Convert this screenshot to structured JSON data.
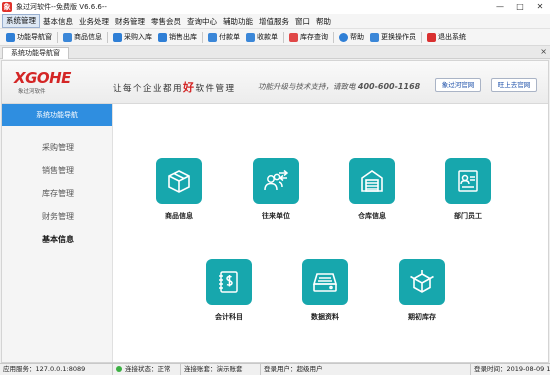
{
  "window": {
    "title": "象过河软件--免费版 V6.6.6--",
    "app_icon_glyph": "象"
  },
  "menubar": [
    "系统管理",
    "基本信息",
    "业务处理",
    "财务管理",
    "零售会员",
    "查询中心",
    "辅助功能",
    "增值服务",
    "窗口",
    "帮助"
  ],
  "toolbar": [
    {
      "label": "功能导航窗",
      "icon": "nav-icon",
      "color": "#2f7fd6"
    },
    {
      "label": "商品信息",
      "icon": "product-icon",
      "color": "#3b87d8"
    },
    {
      "label": "采购入库",
      "icon": "purchase-icon",
      "color": "#2f7fd6"
    },
    {
      "label": "销售出库",
      "icon": "sales-icon",
      "color": "#2f7fd6"
    },
    {
      "label": "付款单",
      "icon": "payment-icon",
      "color": "#3b87d8"
    },
    {
      "label": "收款单",
      "icon": "receipt-icon",
      "color": "#3b87d8"
    },
    {
      "label": "库存查询",
      "icon": "inventory-icon",
      "color": "#e04848"
    },
    {
      "label": "帮助",
      "icon": "help-icon",
      "color": "#2f7fd6"
    },
    {
      "label": "更换操作员",
      "icon": "switch-user-icon",
      "color": "#3b87d8"
    },
    {
      "label": "退出系统",
      "icon": "exit-icon",
      "color": "#d93030"
    }
  ],
  "tab": {
    "label": "系统功能导航窗",
    "close": "×"
  },
  "banner": {
    "brand": "XGOHE",
    "brand_sub": "象过河软件",
    "slogan_before": "让每个企业都用",
    "slogan_highlight": "好",
    "slogan_after": "软件管理",
    "support_text": "功能升级与技术支持，请致电",
    "support_phone": "400-600-1168",
    "btn_official": "象过河官网",
    "btn_shop": "旺上去官网"
  },
  "sidebar": {
    "header": "系统功能导航",
    "items": [
      "采购管理",
      "销售管理",
      "库存管理",
      "财务管理",
      "基本信息"
    ],
    "active_index": 4
  },
  "tiles": [
    {
      "label": "商品信息",
      "icon": "box-icon"
    },
    {
      "label": "往来单位",
      "icon": "contacts-icon"
    },
    {
      "label": "仓库信息",
      "icon": "warehouse-icon"
    },
    {
      "label": "部门员工",
      "icon": "id-card-icon"
    },
    {
      "label": "会计科目",
      "icon": "ledger-icon"
    },
    {
      "label": "数据资料",
      "icon": "drive-icon"
    },
    {
      "label": "期初库存",
      "icon": "cube-icon"
    }
  ],
  "colors": {
    "tile": "#17a7ad",
    "sidebar_header": "#2f8ee0",
    "brand": "#d42626"
  },
  "statusbar": {
    "server": "应用服务：127.0.0.1:8089",
    "connection": "连接状态：正常",
    "account": "连接账套：演示账套",
    "user": "登录用户：超级用户",
    "date": "登录时间：2019-08-09 1"
  }
}
